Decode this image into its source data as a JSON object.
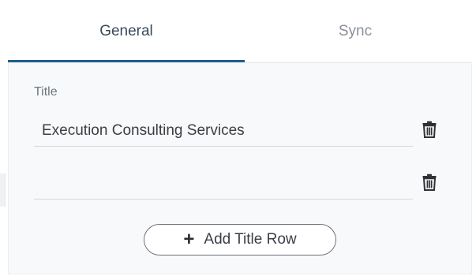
{
  "tabs": [
    {
      "label": "General",
      "active": true
    },
    {
      "label": "Sync",
      "active": false
    }
  ],
  "title_section": {
    "label": "Title",
    "rows": [
      {
        "value": "Execution Consulting Services",
        "placeholder": ""
      },
      {
        "value": "",
        "placeholder": ""
      }
    ],
    "delete_icon": "trash-icon"
  },
  "add_row_button": {
    "icon": "plus-icon",
    "label": "Add Title Row"
  },
  "colors": {
    "accent": "#1f5f8b",
    "tab_inactive": "#8a9099",
    "content_bg": "#f8f9fa"
  }
}
